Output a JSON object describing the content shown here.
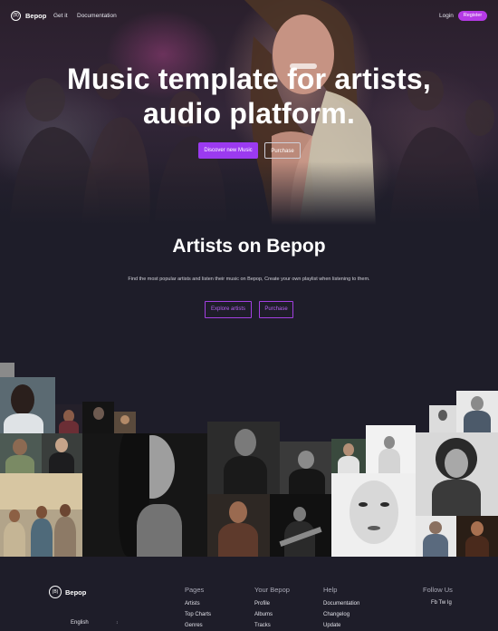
{
  "nav": {
    "logo_mark": "(B)",
    "brand": "Bepop",
    "links": [
      "Get it",
      "Documentation"
    ],
    "login": "Login",
    "register": "Register"
  },
  "hero": {
    "title_line1": "Music template for artists,",
    "title_line2": "audio platform.",
    "discover_button": "Discover new Music",
    "purchase_button": "Purchase"
  },
  "artists_section": {
    "title": "Artists on Bepop",
    "description": "Find the most popular artists and listen their music on Bepop, Create your own playlist when listening to them.",
    "explore_button": "Explore artists",
    "purchase_button": "Purchase"
  },
  "colors": {
    "accent": "#9b3af0",
    "background": "#1e1d29",
    "register": "#b53ae6"
  },
  "footer": {
    "brand": "Bepop",
    "logo_mark": "(B)",
    "columns": [
      {
        "heading": "Pages",
        "items": [
          "Artists",
          "Top Charts",
          "Genres"
        ]
      },
      {
        "heading": "Your Bepop",
        "items": [
          "Profile",
          "Albums",
          "Tracks"
        ]
      },
      {
        "heading": "Help",
        "items": [
          "Documentation",
          "Changelog",
          "Update"
        ]
      }
    ],
    "follow_heading": "Follow Us",
    "social_text": "Fb Tw Ig",
    "language": "English",
    "language_caret": "↕"
  }
}
